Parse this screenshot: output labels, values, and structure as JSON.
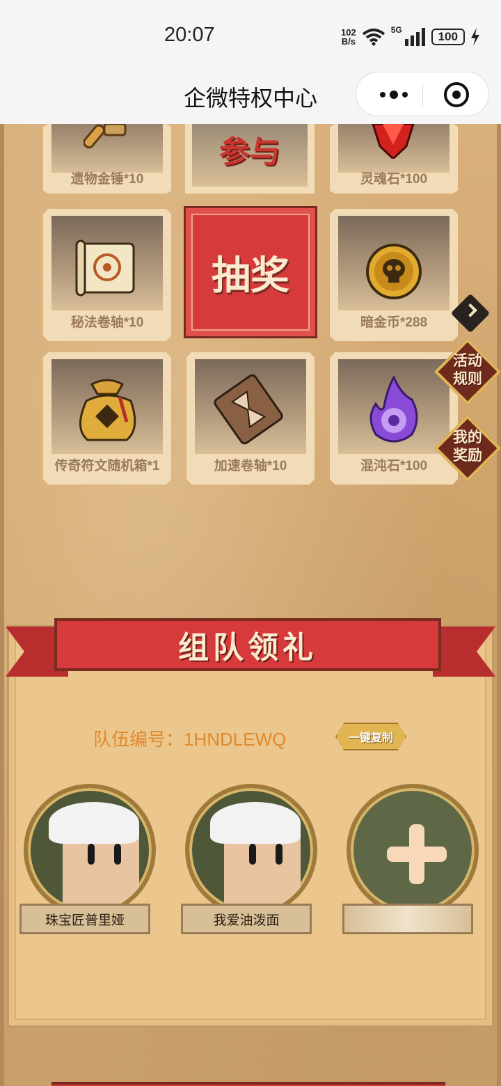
{
  "status_bar": {
    "time": "20:07",
    "net_speed_value": "102",
    "net_speed_unit": "B/s",
    "network_type": "5G",
    "battery": "100",
    "icons": [
      "wifi-icon",
      "signal-icon",
      "battery-icon",
      "charging-icon"
    ]
  },
  "title_bar": {
    "title": "企微特权中心",
    "icons": [
      "more-icon",
      "close-mini-program-icon"
    ]
  },
  "lottery": {
    "top_row": [
      {
        "label": "遗物金锤*10",
        "icon": "gold-hammer-icon"
      },
      {
        "label": "参与",
        "icon": "join-text"
      },
      {
        "label": "灵魂石*100",
        "icon": "red-gem-icon"
      }
    ],
    "middle_row": [
      {
        "label": "秘法卷轴*10",
        "icon": "scroll-icon"
      },
      {
        "label": "暗金币*288",
        "icon": "skull-coin-icon"
      }
    ],
    "draw_label": "抽奖",
    "bottom_row": [
      {
        "label": "传奇符文随机箱*1",
        "icon": "rune-bag-icon"
      },
      {
        "label": "加速卷轴*10",
        "icon": "hourglass-scroll-icon"
      },
      {
        "label": "混沌石*100",
        "icon": "purple-flame-icon"
      }
    ]
  },
  "side_buttons": {
    "rules": "活动\n规则",
    "rules_line1": "活动",
    "rules_line2": "规则",
    "my_rewards_line1": "我的",
    "my_rewards_line2": "奖励"
  },
  "team": {
    "banner_title": "组队领礼",
    "team_id_text": "队伍编号：1HNDLEWQ",
    "copy_label": "一键复制",
    "members": [
      {
        "name": "珠宝匠普里娅"
      },
      {
        "name": "我爱油泼面"
      }
    ],
    "add_slot_name": ""
  },
  "colors": {
    "accent_red": "#d63a3a",
    "parchment": "#ebc68d",
    "team_id_orange": "#e08a2c"
  }
}
